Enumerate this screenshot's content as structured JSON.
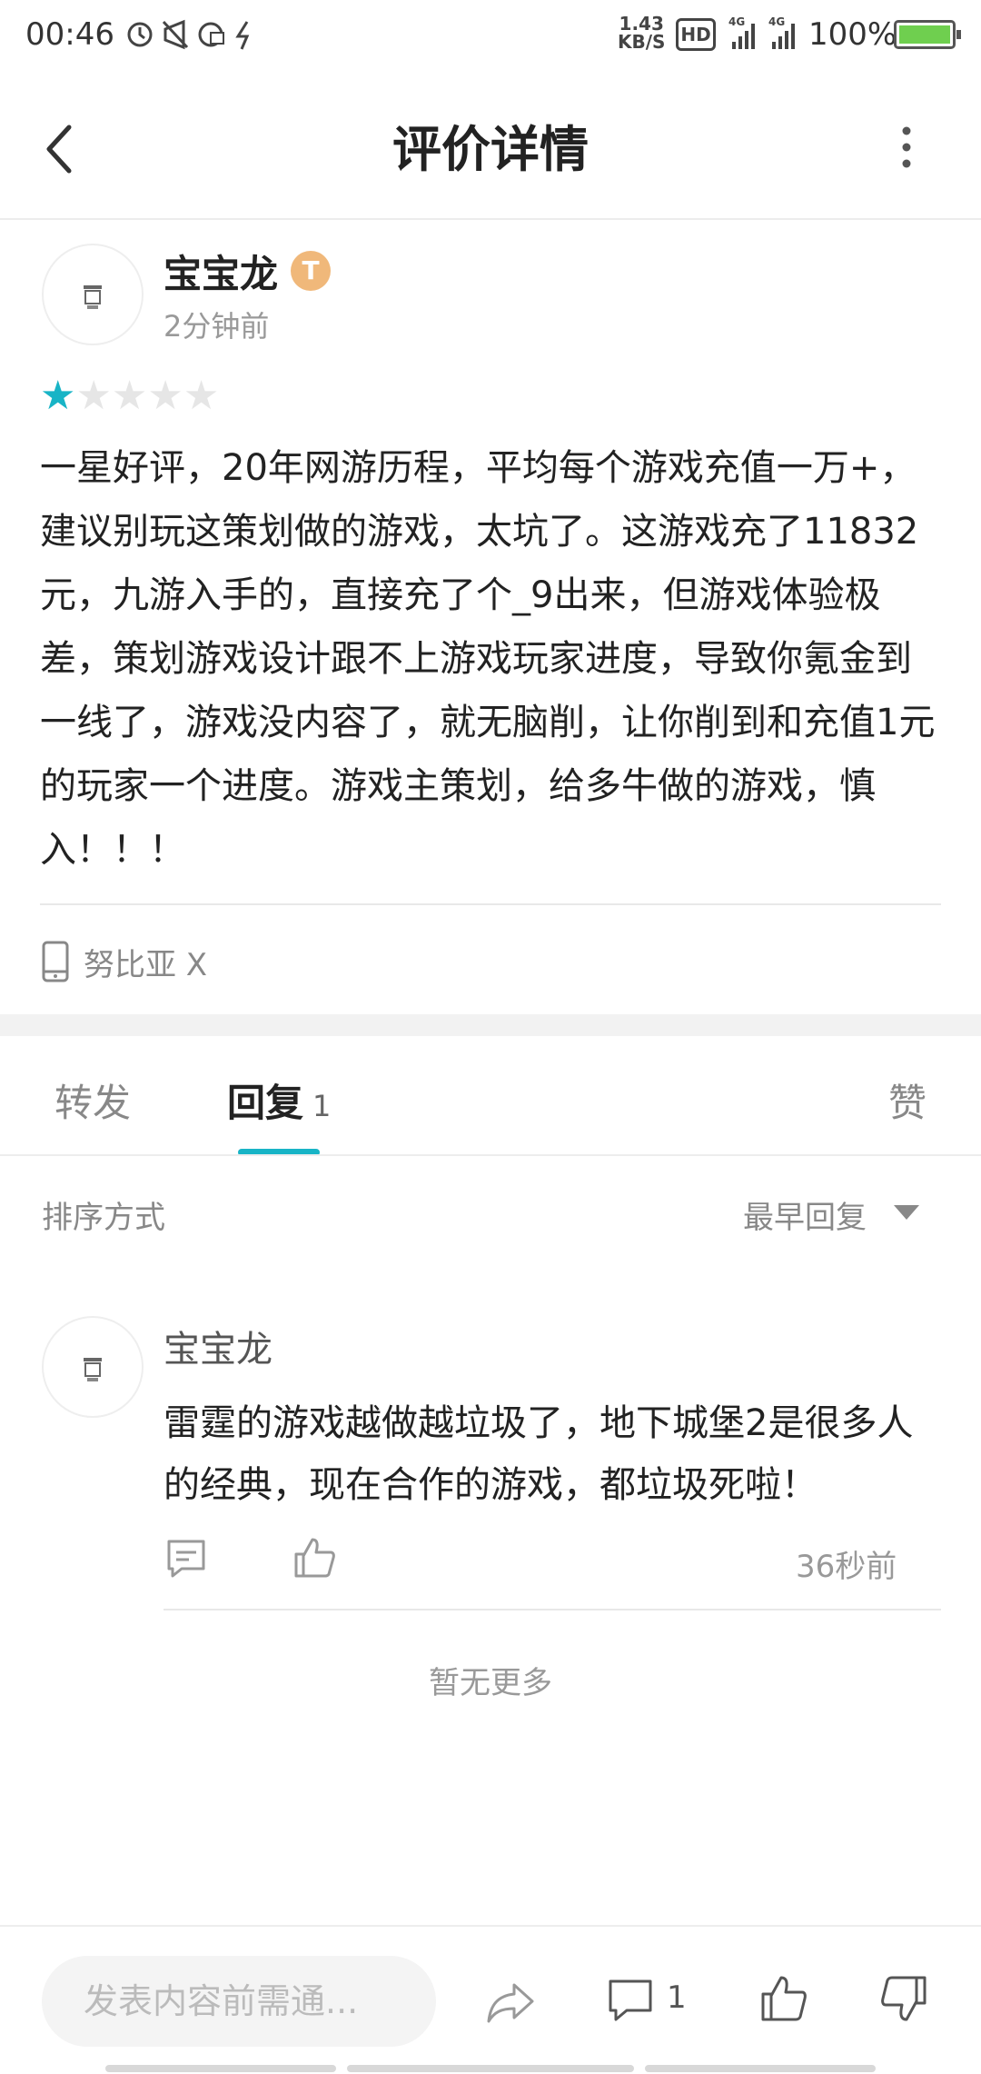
{
  "status_bar": {
    "time": "00:46",
    "net_speed": "1.43",
    "net_unit": "KB/S",
    "hd": "HD",
    "sim1": "4G",
    "sim2": "4G",
    "battery": "100%"
  },
  "header": {
    "title": "评价详情"
  },
  "review": {
    "username": "宝宝龙",
    "badge": "T",
    "time_ago": "2分钟前",
    "rating": 1,
    "rating_max": 5,
    "text": "一星好评，20年网游历程，平均每个游戏充值一万+，建议别玩这策划做的游戏，太坑了。这游戏充了11832元，九游入手的，直接充了个_9出来，但游戏体验极差，策划游戏设计跟不上游戏玩家进度，导致你氪金到一线了，游戏没内容了，就无脑削，让你削到和充值1元的玩家一个进度。游戏主策划，给多牛做的游戏，慎入！！！",
    "device": "努比亚 X"
  },
  "tabs": {
    "forward": "转发",
    "reply": "回复",
    "reply_count": "1",
    "like": "赞"
  },
  "sort": {
    "label": "排序方式",
    "value": "最早回复"
  },
  "comment": {
    "username": "宝宝龙",
    "text": "雷霆的游戏越做越垃圾了，地下城堡2是很多人的经典，现在合作的游戏，都垃圾死啦！",
    "time": "36秒前"
  },
  "no_more": "暂无更多",
  "bottom_bar": {
    "input_placeholder": "发表内容前需通...",
    "comment_count": "1"
  },
  "colors": {
    "accent": "#18b4c6",
    "badge": "#f0b87a"
  }
}
